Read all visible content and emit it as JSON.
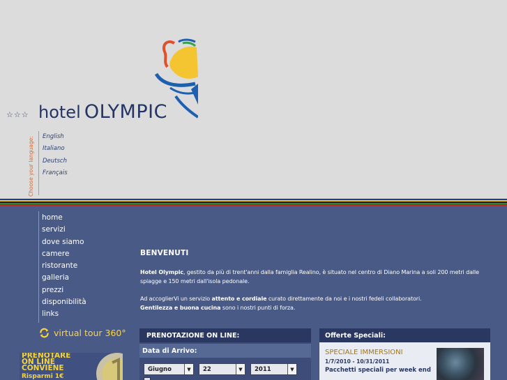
{
  "header": {
    "stars": "☆☆☆",
    "brand_prefix": "hotel",
    "brand_name": "OLYMPIC"
  },
  "language": {
    "caption": "Choose your language:",
    "options": [
      "English",
      "Italiano",
      "Deutsch",
      "Français"
    ]
  },
  "nav": {
    "items": [
      "home",
      "servizi",
      "dove siamo",
      "camere",
      "ristorante",
      "galleria",
      "prezzi",
      "disponibilità",
      "links"
    ]
  },
  "virtual_tour": {
    "label": "virtual tour 360°"
  },
  "promo": {
    "line1": "PRENOTARE",
    "line2": "ON LINE",
    "line3": "CONVIENE",
    "save": "Risparmi 1€"
  },
  "welcome": {
    "title": "BENVENUTI",
    "p1_bold": "Hotel Olympic",
    "p1_text": ", gestito da più di trent'anni dalla famiglia Realino, è situato nel centro di Diano Marina a soli 200 metri dalle spiagge e 150 metri dall'isola pedonale.",
    "p2_text_a": "Ad accoglierVi un servizio ",
    "p2_bold_a": "attento e cordiale",
    "p2_text_b": " curato direttamente da noi e i nostri fedeli collaboratori.",
    "p2_bold_b": "Gentilezza e buona cucina",
    "p2_text_c": " sono i nostri punti di forza."
  },
  "booking": {
    "title": "PRENOTAZIONE ON LINE:",
    "arrival_label": "Data di Arrivo:",
    "month": "Giugno",
    "day": "22",
    "year": "2011"
  },
  "offers": {
    "title": "Offerte Speciali:",
    "offer_title": "SPECIALE IMMERSIONI",
    "offer_dates": "1/7/2010 - 10/31/2011",
    "offer_desc": "Pacchetti speciali per week end"
  },
  "colors": {
    "header_bg": "#dcdcdc",
    "main_bg": "#4a5a86",
    "brand": "#243466",
    "accent_yellow": "#ffd43a",
    "stripe": [
      "#1f3a8f",
      "#f2c600",
      "#1a1a1a",
      "#1e8a3a",
      "#c8201e"
    ]
  }
}
